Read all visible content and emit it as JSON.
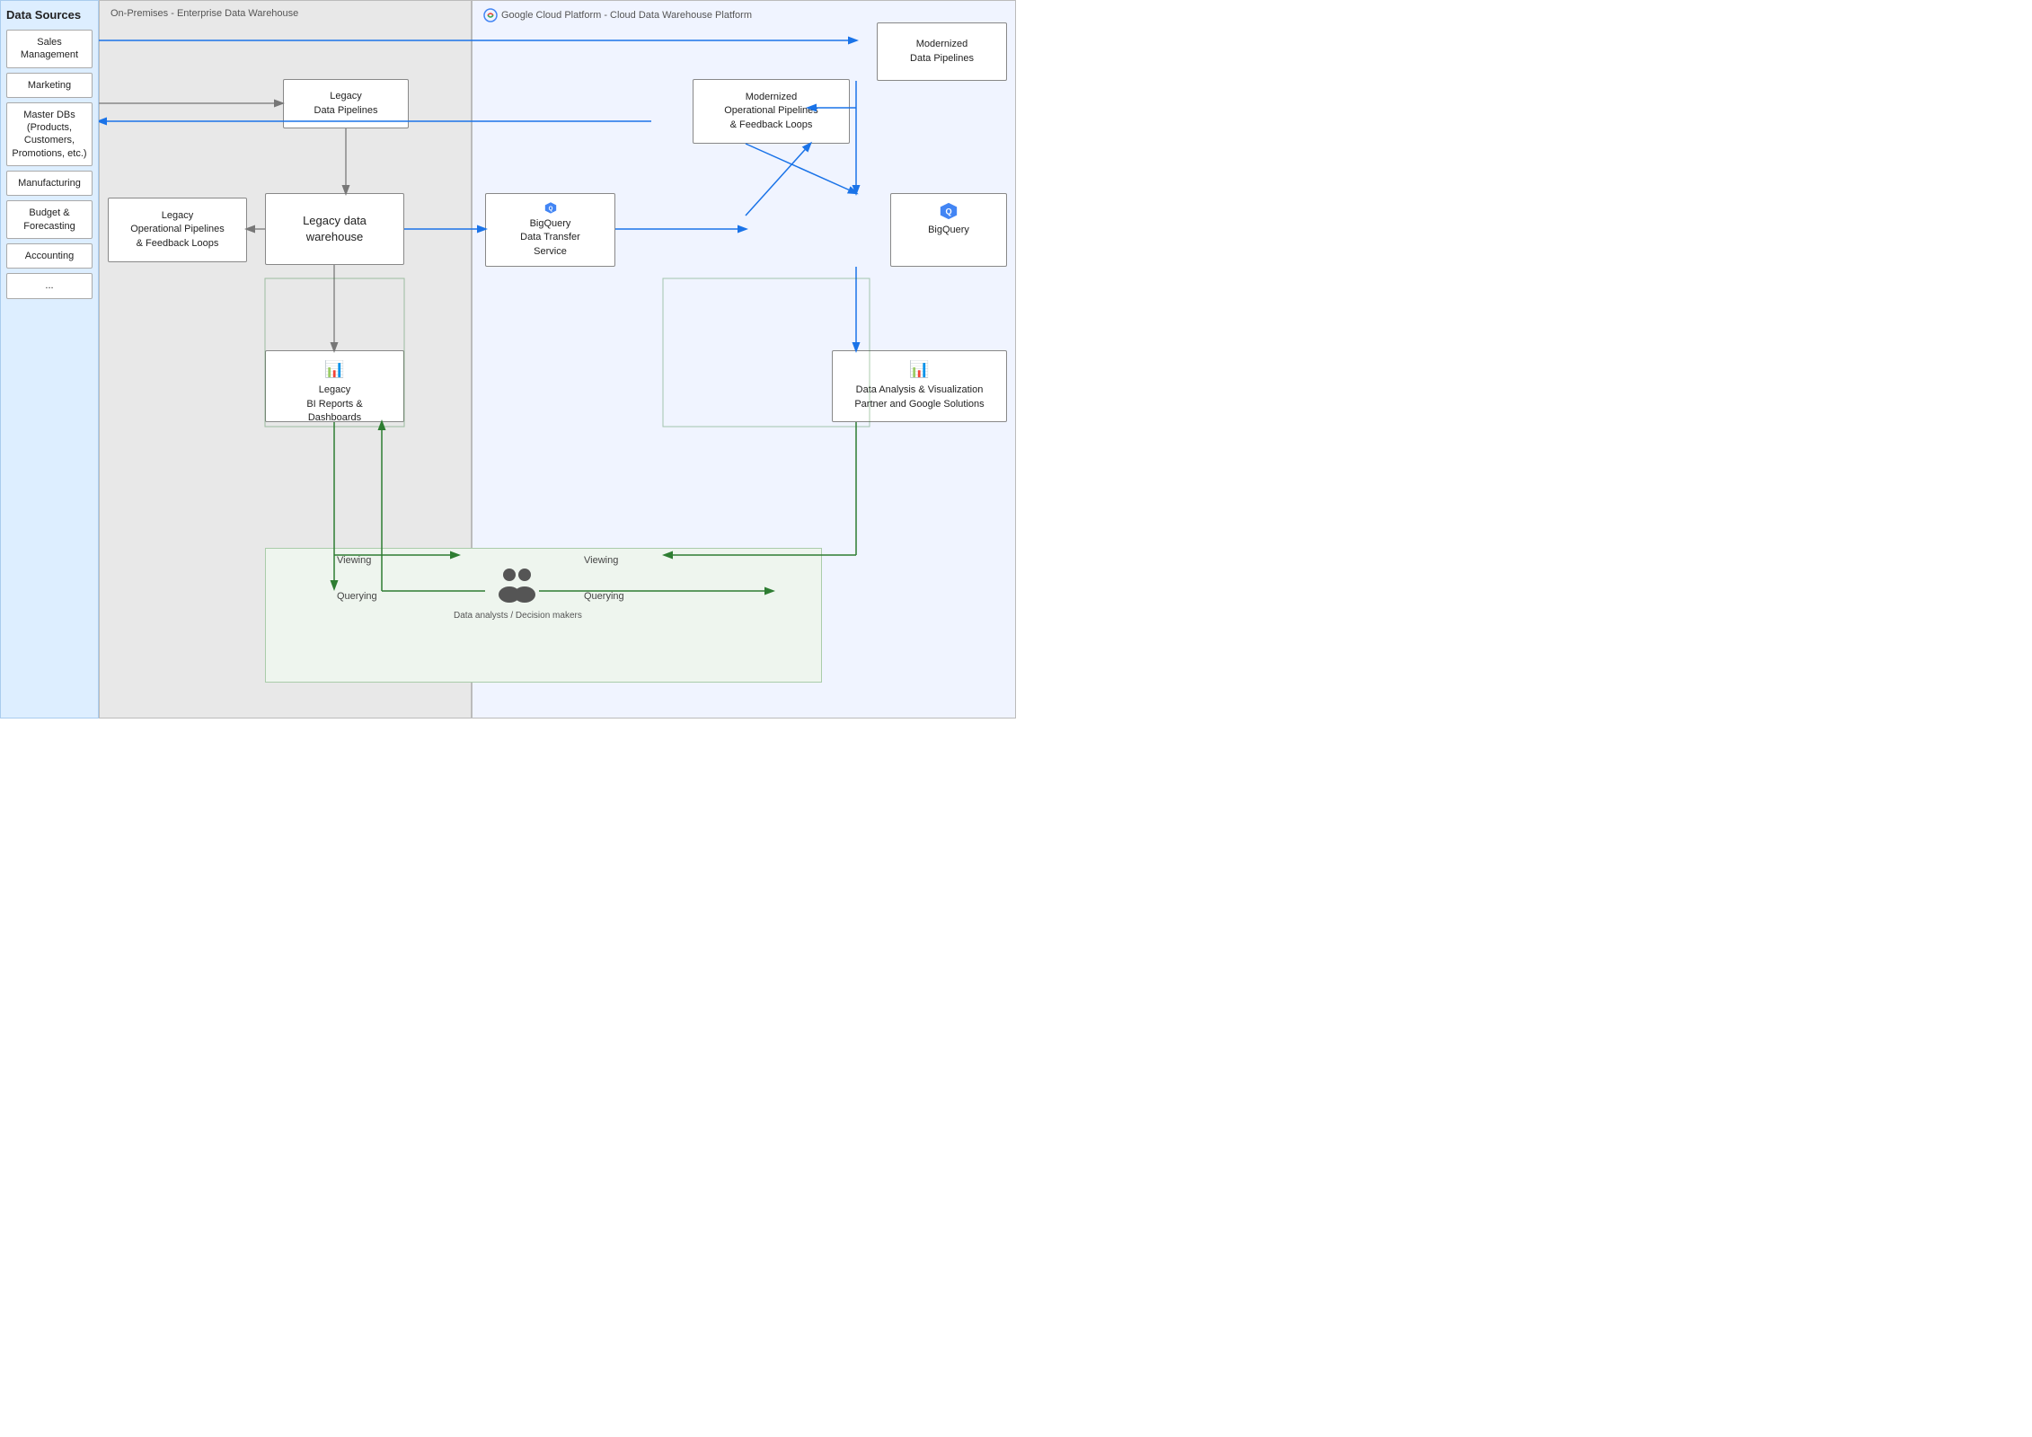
{
  "dataSources": {
    "title": "Data Sources",
    "items": [
      {
        "label": "Sales Management"
      },
      {
        "label": "Marketing"
      },
      {
        "label": "Master DBs (Products, Customers, Promotions, etc.)"
      },
      {
        "label": "Manufacturing"
      },
      {
        "label": "Budget & Forecasting"
      },
      {
        "label": "Accounting"
      },
      {
        "label": "..."
      }
    ]
  },
  "regions": {
    "onPremises": "On-Premises - Enterprise Data Warehouse",
    "gcp": "Google Cloud Platform - Cloud Data Warehouse Platform"
  },
  "nodes": {
    "legacyDataPipelines": "Legacy\nData Pipelines",
    "legacyDataWarehouse": "Legacy data\nwarehouse",
    "legacyOpPipelines": "Legacy\nOperational Pipelines\n& Feedback Loops",
    "legacyBIReports": "Legacy\nBI Reports &\nDashboards",
    "modernizedDataPipelines": "Modernized\nData Pipelines",
    "modernizedOpPipelines": "Modernized\nOperational Pipelines\n& Feedback Loops",
    "bigQueryDTS": "BigQuery\nData Transfer\nService",
    "bigQuery": "BigQuery",
    "dataAnalysis": "Data Analysis & Visualization\nPartner and Google Solutions"
  },
  "labels": {
    "viewing": "Viewing",
    "querying": "Querying",
    "dataAnalysts": "Data analysts / Decision makers"
  }
}
